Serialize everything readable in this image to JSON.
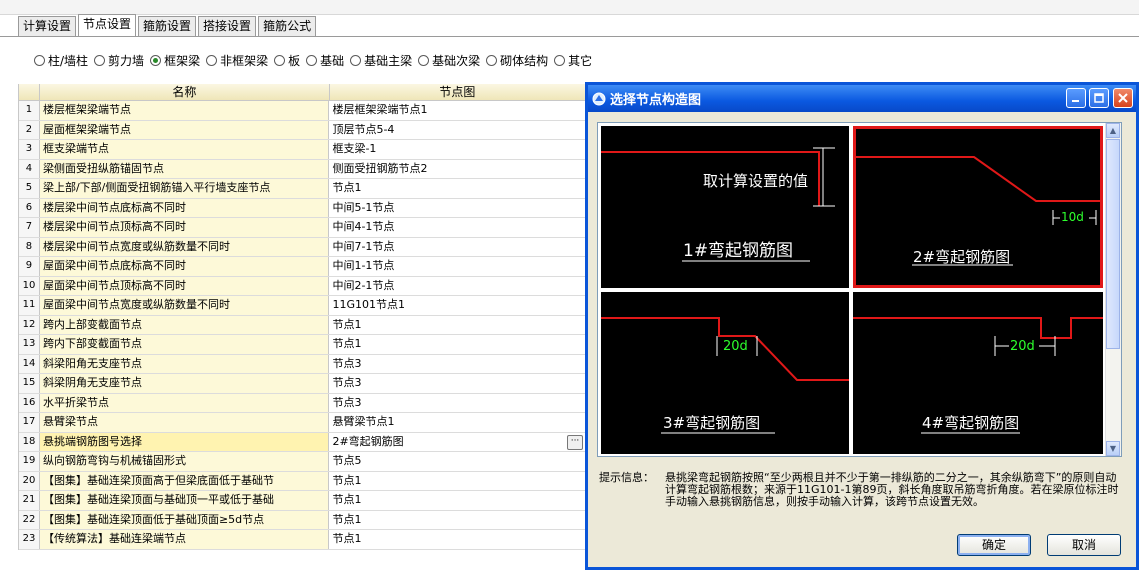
{
  "tabs": [
    "计算设置",
    "节点设置",
    "箍筋设置",
    "搭接设置",
    "箍筋公式"
  ],
  "active_tab": 1,
  "radios": {
    "options": [
      "柱/墙柱",
      "剪力墙",
      "框架梁",
      "非框架梁",
      "板",
      "基础",
      "基础主梁",
      "基础次梁",
      "砌体结构",
      "其它"
    ],
    "selected": 2
  },
  "table": {
    "headers": [
      "名称",
      "节点图"
    ],
    "rows": [
      {
        "n": "1",
        "name": "楼层框架梁端节点",
        "value": "楼层框架梁端节点1"
      },
      {
        "n": "2",
        "name": "屋面框架梁端节点",
        "value": "顶层节点5-4"
      },
      {
        "n": "3",
        "name": "框支梁端节点",
        "value": "框支梁-1"
      },
      {
        "n": "4",
        "name": "梁侧面受扭纵筋锚固节点",
        "value": "侧面受扭钢筋节点2"
      },
      {
        "n": "5",
        "name": "梁上部/下部/侧面受扭钢筋锚入平行墙支座节点",
        "value": "节点1"
      },
      {
        "n": "6",
        "name": "楼层梁中间节点底标高不同时",
        "value": "中间5-1节点"
      },
      {
        "n": "7",
        "name": "楼层梁中间节点顶标高不同时",
        "value": "中间4-1节点"
      },
      {
        "n": "8",
        "name": "楼层梁中间节点宽度或纵筋数量不同时",
        "value": "中间7-1节点"
      },
      {
        "n": "9",
        "name": "屋面梁中间节点底标高不同时",
        "value": "中间1-1节点"
      },
      {
        "n": "10",
        "name": "屋面梁中间节点顶标高不同时",
        "value": "中间2-1节点"
      },
      {
        "n": "11",
        "name": "屋面梁中间节点宽度或纵筋数量不同时",
        "value": "11G101节点1"
      },
      {
        "n": "12",
        "name": "跨内上部变截面节点",
        "value": "节点1"
      },
      {
        "n": "13",
        "name": "跨内下部变截面节点",
        "value": "节点1"
      },
      {
        "n": "14",
        "name": "斜梁阳角无支座节点",
        "value": "节点3"
      },
      {
        "n": "15",
        "name": "斜梁阴角无支座节点",
        "value": "节点3"
      },
      {
        "n": "16",
        "name": "水平折梁节点",
        "value": "节点3"
      },
      {
        "n": "17",
        "name": "悬臂梁节点",
        "value": "悬臂梁节点1"
      },
      {
        "n": "18",
        "name": "悬挑端钢筋图号选择",
        "value": "2#弯起钢筋图"
      },
      {
        "n": "19",
        "name": "纵向钢筋弯钩与机械锚固形式",
        "value": "节点5"
      },
      {
        "n": "20",
        "name": "【图集】基础连梁顶面高于但梁底面低于基础节",
        "value": "节点1"
      },
      {
        "n": "21",
        "name": "【图集】基础连梁顶面与基础顶一平或低于基础",
        "value": "节点1"
      },
      {
        "n": "22",
        "name": "【图集】基础连梁顶面低于基础顶面≥5d节点",
        "value": "节点1"
      },
      {
        "n": "23",
        "name": "【传统算法】基础连梁端节点",
        "value": "节点1"
      }
    ],
    "selected_row": 17,
    "ellipsis": "···"
  },
  "dialog": {
    "title": "选择节点构造图",
    "cells": [
      {
        "caption": "1#弯起钢筋图",
        "annotation": "取计算设置的值"
      },
      {
        "caption": "2#弯起钢筋图",
        "annotation": "10d"
      },
      {
        "caption": "3#弯起钢筋图",
        "annotation": "20d"
      },
      {
        "caption": "4#弯起钢筋图",
        "annotation": "20d"
      }
    ],
    "selected_cell": 1,
    "info_label": "提示信息：",
    "info_text": "悬挑梁弯起钢筋按照“至少两根且并不少于第一排纵筋的二分之一，其余纵筋弯下”的原则自动计算弯起钢筋根数；来源于11G101-1第89页，斜长角度取吊筋弯折角度。若在梁原位标注时手动输入悬挑钢筋信息，则按手动输入计算，该跨节点设置无效。",
    "ok": "确定",
    "cancel": "取消"
  },
  "colors": {
    "accent_blue": "#0a55d8",
    "rebar_red": "#e01818",
    "dim_green": "#2dff2d"
  }
}
